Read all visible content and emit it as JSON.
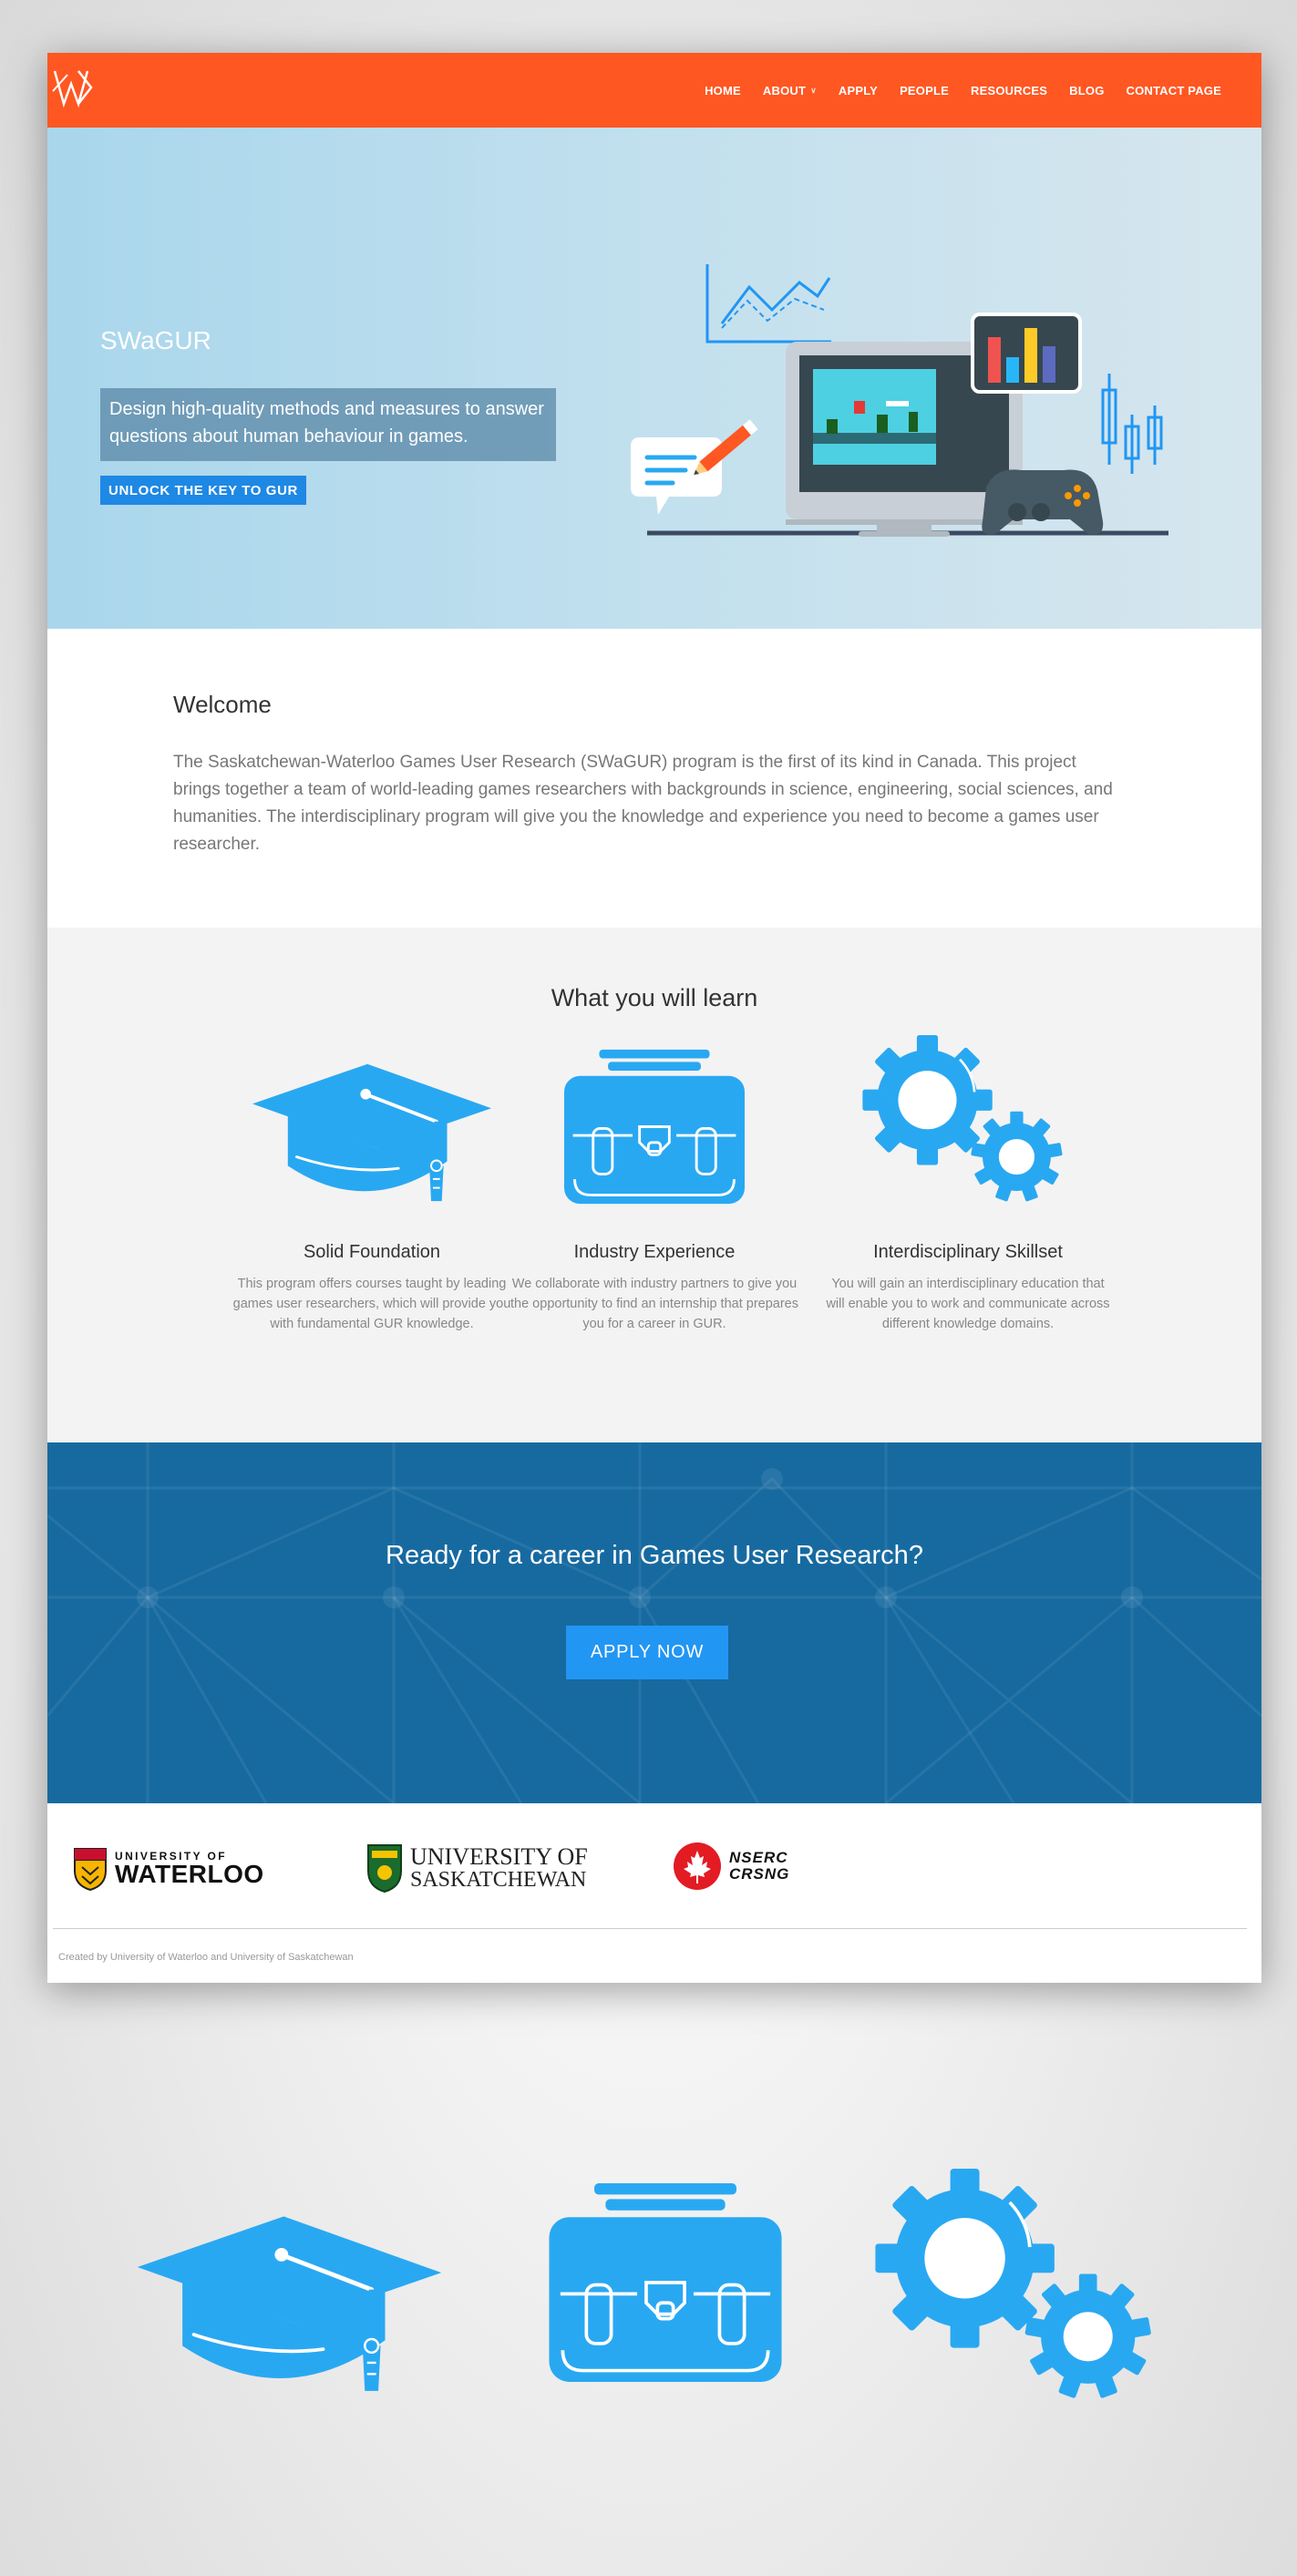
{
  "nav": {
    "logo_text": "JW",
    "items": [
      {
        "label": "HOME"
      },
      {
        "label": "ABOUT",
        "has_dropdown": true
      },
      {
        "label": "APPLY"
      },
      {
        "label": "PEOPLE"
      },
      {
        "label": "RESOURCES"
      },
      {
        "label": "BLOG"
      },
      {
        "label": "CONTACT PAGE"
      }
    ]
  },
  "hero": {
    "title": "SWaGUR",
    "tagline": "Design high-quality methods and measures to answer questions about human behaviour in games.",
    "button": "UNLOCK THE KEY TO GUR"
  },
  "welcome": {
    "heading": "Welcome",
    "body": "The Saskatchewan-Waterloo Games User Research (SWaGUR) program is the first of its kind in Canada. This project brings together a team of world-leading games researchers with backgrounds in science, engineering, social sciences, and humanities. The interdisciplinary program will give you the knowledge and experience you need to become a games user researcher."
  },
  "learn": {
    "heading": "What you will learn",
    "features": [
      {
        "icon": "graduation-cap-icon",
        "title": "Solid Foundation",
        "text": "This program offers courses taught by leading games user researchers, which will provide you with fundamental GUR knowledge."
      },
      {
        "icon": "briefcase-icon",
        "title": "Industry Experience",
        "text": "We collaborate with industry partners to give you the opportunity to find an internship that prepares you for a career in GUR."
      },
      {
        "icon": "gears-icon",
        "title": "Interdisciplinary Skillset",
        "text": "You will gain an interdisciplinary education that will enable you to work and communicate across different knowledge domains."
      }
    ]
  },
  "cta": {
    "heading": "Ready for a career in Games User Research?",
    "button": "APPLY NOW"
  },
  "partners": {
    "waterloo": {
      "line1": "UNIVERSITY OF",
      "line2": "WATERLOO"
    },
    "saskatchewan": {
      "line1": "UNIVERSITY OF",
      "line2": "SASKATCHEWAN"
    },
    "nserc": {
      "line1": "NSERC",
      "line2": "CRSNG"
    }
  },
  "footer": {
    "credit": "Created by University of Waterloo and University of Saskatchewan"
  },
  "colors": {
    "nav": "#ff5722",
    "accent": "#2196f3",
    "icon_blue": "#29a8f2",
    "cta_bg": "#176aa0"
  }
}
